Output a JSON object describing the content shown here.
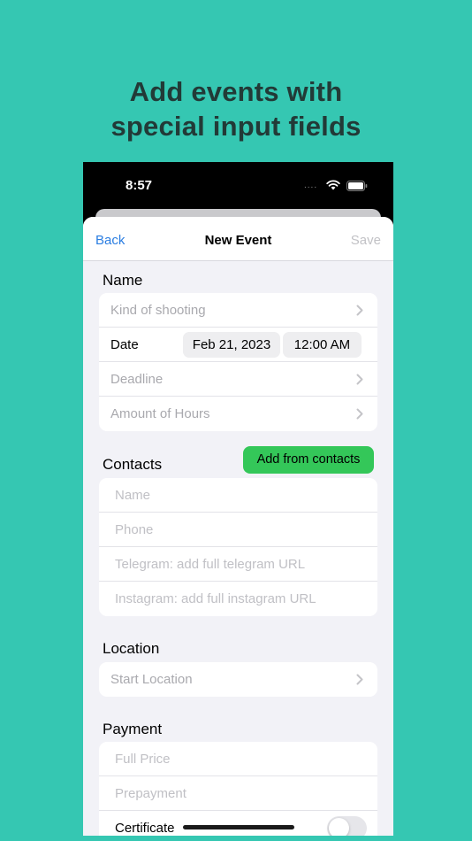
{
  "promo": {
    "line1": "Add events with",
    "line2": "special input fields"
  },
  "status_bar": {
    "time": "8:57",
    "signal": "....",
    "icons": [
      "wifi-icon",
      "battery-icon"
    ]
  },
  "nav": {
    "back": "Back",
    "title": "New Event",
    "save": "Save"
  },
  "name_section": {
    "title": "Name",
    "kind_of_shooting": "Kind of shooting",
    "date_label": "Date",
    "date_value": "Feb 21, 2023",
    "time_value": "12:00 AM",
    "deadline": "Deadline",
    "amount_of_hours": "Amount of Hours"
  },
  "contacts_section": {
    "title": "Contacts",
    "add_button": "Add from contacts",
    "name_placeholder": "Name",
    "phone_placeholder": "Phone",
    "telegram_placeholder": "Telegram: add full telegram URL",
    "instagram_placeholder": "Instagram: add full instagram URL"
  },
  "location_section": {
    "title": "Location",
    "start_location": "Start Location"
  },
  "payment_section": {
    "title": "Payment",
    "full_price_placeholder": "Full Price",
    "prepayment_placeholder": "Prepayment",
    "certificate_label": "Certificate",
    "certificate_on": false
  },
  "colors": {
    "background": "#35c7b2",
    "accent": "#2a7de1",
    "button_green": "#34c759",
    "sheet": "#f2f2f7"
  }
}
